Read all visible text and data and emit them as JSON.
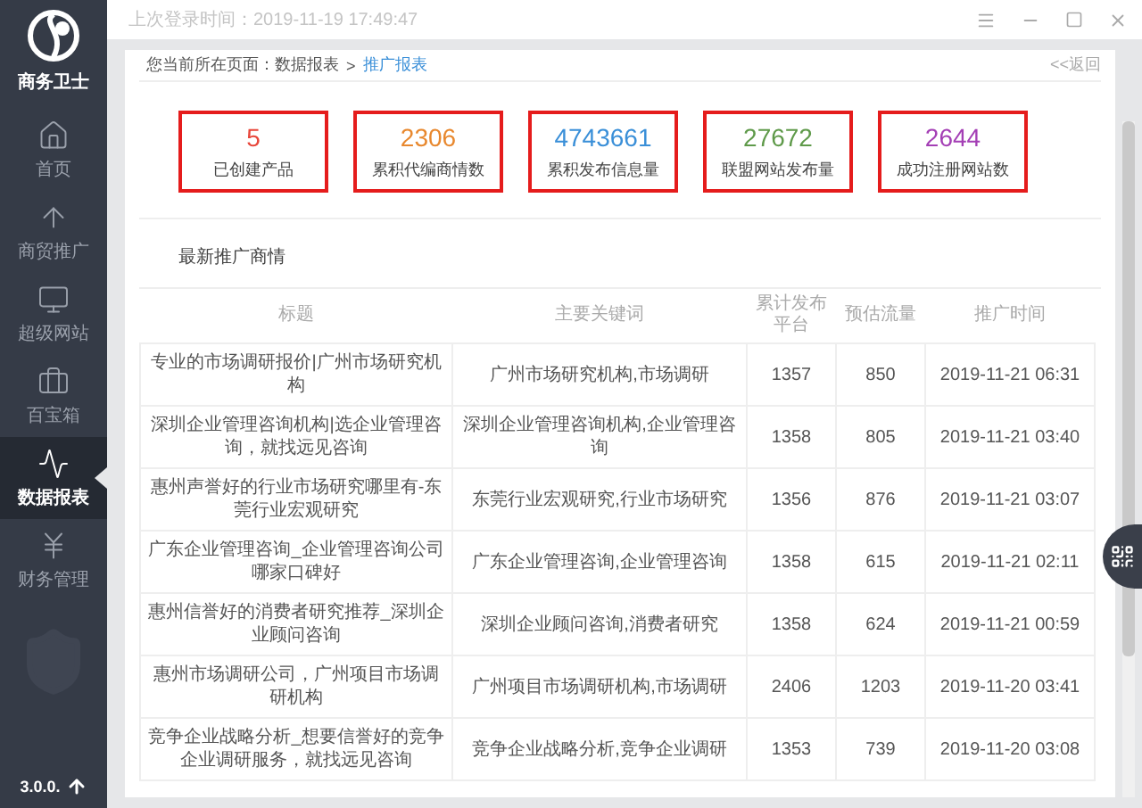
{
  "app": {
    "name": "商务卫士",
    "version": "3.0.0."
  },
  "sidebar": {
    "items": [
      {
        "label": "首页",
        "selected": false
      },
      {
        "label": "商贸推广",
        "selected": false
      },
      {
        "label": "超级网站",
        "selected": false
      },
      {
        "label": "百宝箱",
        "selected": false
      },
      {
        "label": "数据报表",
        "selected": true
      },
      {
        "label": "财务管理",
        "selected": false
      }
    ]
  },
  "topbar": {
    "last_login": "上次登录时间：2019-11-19 17:49:47"
  },
  "breadcrumb": {
    "prefix": "您当前所在页面：数据报表",
    "separator": ">",
    "current": "推广报表",
    "back": "<<返回"
  },
  "stats": [
    {
      "value": "5",
      "label": "已创建产品",
      "color": "#e8463a"
    },
    {
      "value": "2306",
      "label": "累积代编商情数",
      "color": "#e8882e"
    },
    {
      "value": "4743661",
      "label": "累积发布信息量",
      "color": "#3a8fd8"
    },
    {
      "value": "27672",
      "label": "联盟网站发布量",
      "color": "#5f9a4a"
    },
    {
      "value": "2644",
      "label": "成功注册网站数",
      "color": "#a43fb5"
    }
  ],
  "section_title": "最新推广商情",
  "table": {
    "columns": [
      "标题",
      "主要关键词",
      "累计发布平台",
      "预估流量",
      "推广时间"
    ],
    "rows": [
      [
        "专业的市场调研报价|广州市场研究机构",
        "广州市场研究机构,市场调研",
        "1357",
        "850",
        "2019-11-21 06:31"
      ],
      [
        "深圳企业管理咨询机构|选企业管理咨询，就找远见咨询",
        "深圳企业管理咨询机构,企业管理咨询",
        "1358",
        "805",
        "2019-11-21 03:40"
      ],
      [
        "惠州声誉好的行业市场研究哪里有-东莞行业宏观研究",
        "东莞行业宏观研究,行业市场研究",
        "1356",
        "876",
        "2019-11-21 03:07"
      ],
      [
        "广东企业管理咨询_企业管理咨询公司哪家口碑好",
        "广东企业管理咨询,企业管理咨询",
        "1358",
        "615",
        "2019-11-21 02:11"
      ],
      [
        "惠州信誉好的消费者研究推荐_深圳企业顾问咨询",
        "深圳企业顾问咨询,消费者研究",
        "1358",
        "624",
        "2019-11-21 00:59"
      ],
      [
        "惠州市场调研公司，广州项目市场调研机构",
        "广州项目市场调研机构,市场调研",
        "2406",
        "1203",
        "2019-11-20 03:41"
      ],
      [
        "竞争企业战略分析_想要信誉好的竞争企业调研服务，就找远见咨询",
        "竞争企业战略分析,竞争企业调研",
        "1353",
        "739",
        "2019-11-20 03:08"
      ]
    ]
  }
}
